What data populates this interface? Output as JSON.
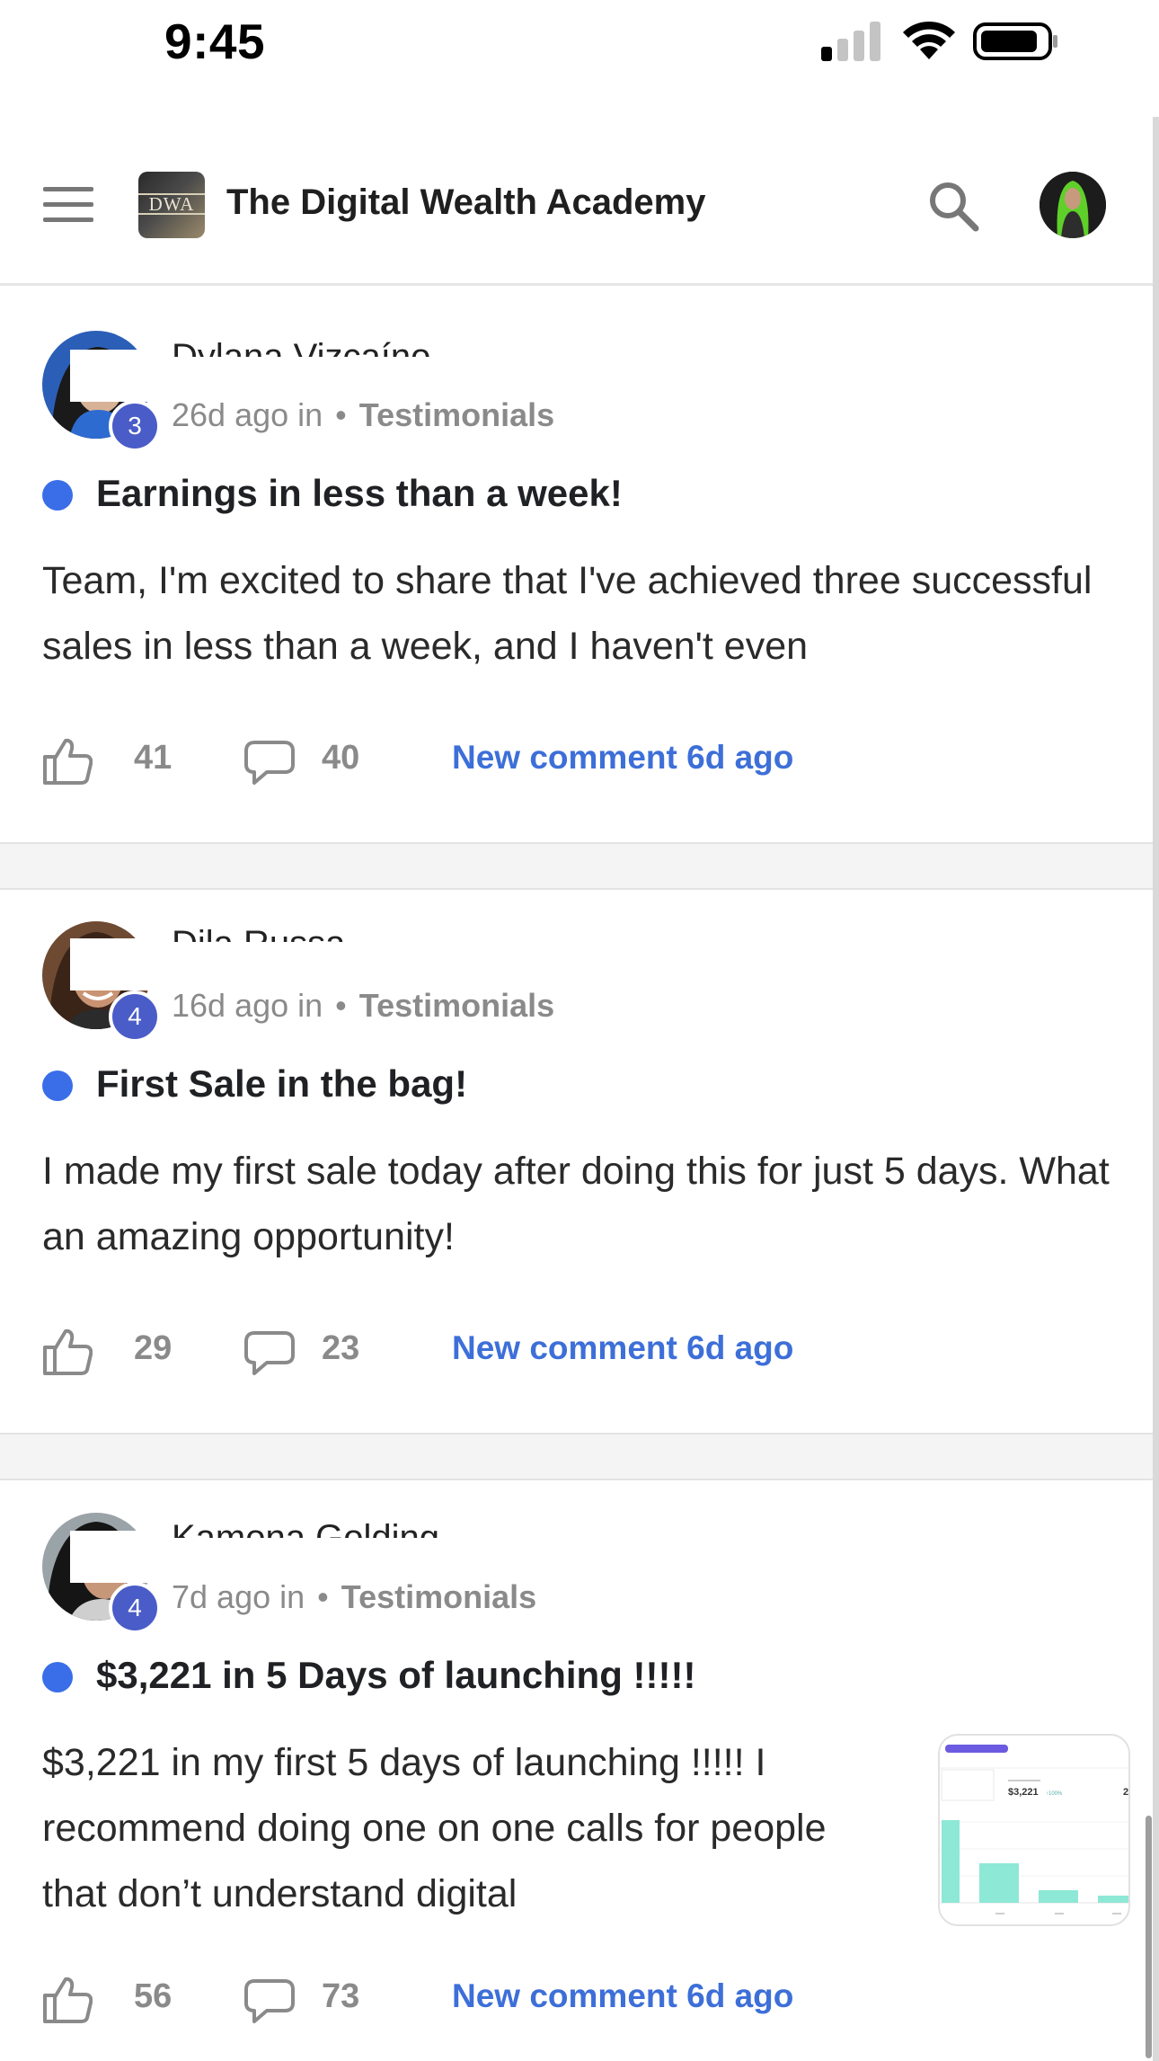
{
  "status_bar": {
    "time": "9:45"
  },
  "header": {
    "title": "The Digital Wealth Academy",
    "logo_text": "DWA"
  },
  "posts": [
    {
      "author": "Dylana Vizcaíno",
      "level": "3",
      "time_ago": "26d ago in",
      "separator": "•",
      "category": "Testimonials",
      "title": "Earnings in less than a week!",
      "body": "Team, I'm excited to share that I've achieved three successful sales in less than a week, and I haven't even",
      "likes": "41",
      "comments": "40",
      "new_comment": "New comment 6d ago"
    },
    {
      "author": "Dila Russa",
      "level": "4",
      "time_ago": "16d ago in",
      "separator": "•",
      "category": "Testimonials",
      "title": "First Sale in the bag!",
      "body": "I made my first sale today after doing this for just 5 days. What an amazing opportunity!",
      "likes": "29",
      "comments": "23",
      "new_comment": "New comment 6d ago"
    },
    {
      "author": "Kamona Golding",
      "level": "4",
      "time_ago": "7d ago in",
      "separator": "•",
      "category": "Testimonials",
      "title": "$3,221 in 5 Days of launching !!!!!",
      "body": "$3,221 in my first 5 days of launching !!!!! I recommend doing one on one calls for people that don’t understand digital",
      "likes": "56",
      "comments": "73",
      "new_comment": "New comment 6d ago",
      "thumbnail": {
        "amount": "$3,221",
        "change": "↑100%",
        "edge_text": "2"
      }
    }
  ],
  "colors": {
    "accent_blue": "#3d6fd8",
    "dot_blue": "#3a6ee8",
    "badge": "#4a5cc7"
  }
}
